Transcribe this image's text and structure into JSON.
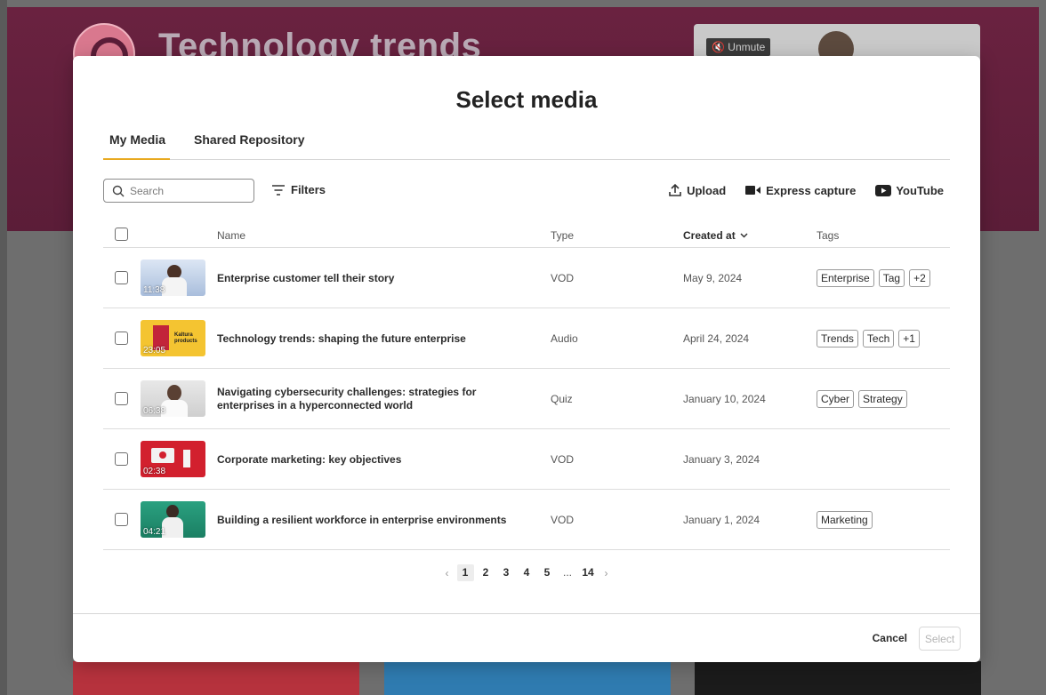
{
  "background": {
    "page_title": "Technology trends",
    "unmute_label": "Unmute"
  },
  "modal": {
    "title": "Select media",
    "tabs": [
      {
        "label": "My Media",
        "active": true
      },
      {
        "label": "Shared Repository",
        "active": false
      }
    ],
    "search": {
      "placeholder": "Search",
      "value": ""
    },
    "filters_label": "Filters",
    "actions": {
      "upload": "Upload",
      "express_capture": "Express capture",
      "youtube": "YouTube"
    },
    "columns": {
      "name": "Name",
      "type": "Type",
      "created_at": "Created at",
      "tags": "Tags"
    },
    "rows": [
      {
        "duration": "11:38",
        "name": "Enterprise customer tell their story",
        "type": "VOD",
        "created": "May 9, 2024",
        "tags": [
          "Enterprise",
          "Tag",
          "+2"
        ]
      },
      {
        "duration": "23:05",
        "thumb_text": "Kaltura products",
        "name": "Technology trends: shaping the future enterprise",
        "type": "Audio",
        "created": "April 24, 2024",
        "tags": [
          "Trends",
          "Tech",
          "+1"
        ]
      },
      {
        "duration": "06:38",
        "name": "Navigating cybersecurity challenges: strategies for enterprises in a hyperconnected world",
        "type": "Quiz",
        "created": "January 10, 2024",
        "tags": [
          "Cyber",
          "Strategy"
        ]
      },
      {
        "duration": "02:38",
        "name": "Corporate marketing: key objectives",
        "type": "VOD",
        "created": "January 3, 2024",
        "tags": []
      },
      {
        "duration": "04:21",
        "name": "Building a resilient workforce in enterprise environments",
        "type": "VOD",
        "created": "January 1, 2024",
        "tags": [
          "Marketing"
        ]
      }
    ],
    "pagination": {
      "pages": [
        "1",
        "2",
        "3",
        "4",
        "5"
      ],
      "ellipsis": "...",
      "last": "14",
      "current": "1",
      "prev": "‹",
      "next": "›"
    },
    "footer": {
      "cancel": "Cancel",
      "select": "Select"
    }
  },
  "colors": {
    "tab_underline": "#e8a91f",
    "hero_bg": "#5b1d38"
  }
}
